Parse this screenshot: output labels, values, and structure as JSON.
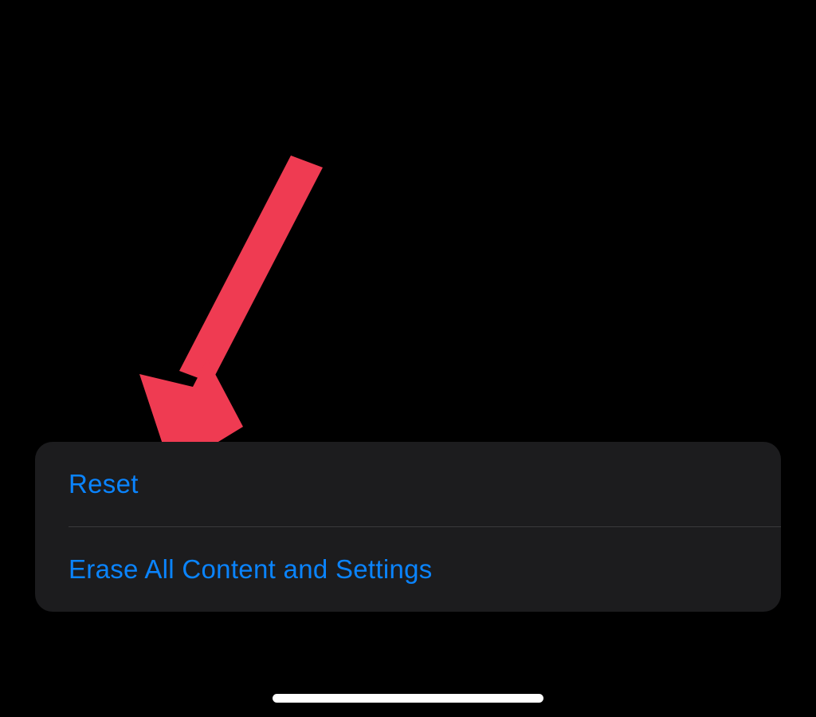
{
  "menu": {
    "items": [
      {
        "label": "Reset"
      },
      {
        "label": "Erase All Content and Settings"
      }
    ]
  },
  "annotation": {
    "arrow_color": "#ef3b52"
  }
}
